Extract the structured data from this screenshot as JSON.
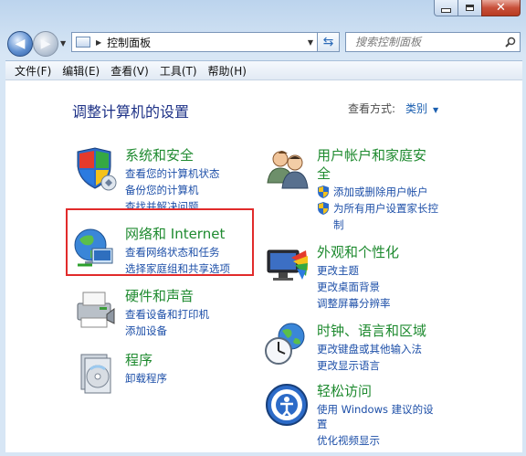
{
  "window": {
    "caption_buttons": [
      "minimize",
      "maximize",
      "close"
    ]
  },
  "address": {
    "breadcrumb": "控制面板",
    "search_placeholder": "搜索控制面板"
  },
  "menu": [
    "文件(F)",
    "编辑(E)",
    "查看(V)",
    "工具(T)",
    "帮助(H)"
  ],
  "content": {
    "heading": "调整计算机的设置",
    "view_by_label": "查看方式:",
    "view_by_value": "类别"
  },
  "left_categories": [
    {
      "title": "系统和安全",
      "icon": "shield-icon",
      "links": [
        "查看您的计算机状态",
        "备份您的计算机",
        "查找并解决问题"
      ]
    },
    {
      "title": "网络和 Internet",
      "icon": "network-globe-icon",
      "links": [
        "查看网络状态和任务",
        "选择家庭组和共享选项"
      ]
    },
    {
      "title": "硬件和声音",
      "icon": "printer-icon",
      "links": [
        "查看设备和打印机",
        "添加设备"
      ]
    },
    {
      "title": "程序",
      "icon": "programs-icon",
      "links": [
        "卸载程序"
      ]
    }
  ],
  "right_categories": [
    {
      "title_line1": "用户帐户和家庭安",
      "title_line2": "全",
      "icon": "users-icon",
      "links": [
        "添加或删除用户帐户",
        "为所有用户设置家长控",
        "制"
      ]
    },
    {
      "title": "外观和个性化",
      "icon": "display-icon",
      "links": [
        "更改主题",
        "更改桌面背景",
        "调整屏幕分辨率"
      ]
    },
    {
      "title": "时钟、语言和区域",
      "icon": "clock-globe-icon",
      "links": [
        "更改键盘或其他输入法",
        "更改显示语言"
      ]
    },
    {
      "title": "轻松访问",
      "icon": "ease-of-access-icon",
      "links": [
        "使用 Windows 建议的设",
        "置",
        "优化视频显示"
      ]
    }
  ],
  "colors": {
    "category_title": "#1e8a2f",
    "link": "#1d4fa8",
    "heading": "#1e3287",
    "highlight_box": "#e12b2b"
  }
}
